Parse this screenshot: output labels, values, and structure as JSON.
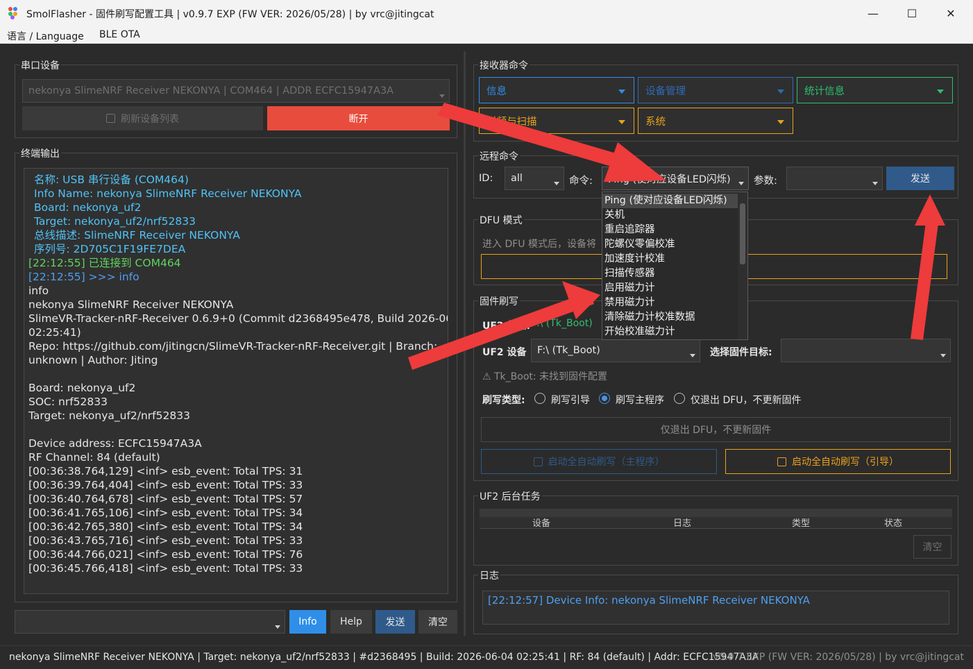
{
  "window": {
    "title": "SmolFlasher - 固件刷写配置工具 | v0.9.7 EXP (FW VER: 2026/05/28) | by vrc@jitingcat",
    "minimize": "—",
    "maximize": "☐",
    "close": "✕"
  },
  "menu": {
    "language": "语言 / Language",
    "ble_ota": "BLE OTA"
  },
  "serial": {
    "group_title": "串口设备",
    "device": "nekonya SlimeNRF Receiver NEKONYA | COM464 | ADDR ECFC15947A3A",
    "refresh_label": "刷新设备列表",
    "disconnect_label": "断开"
  },
  "terminal": {
    "group_title": "终端输出",
    "lines": [
      {
        "text": "名称: USB 串行设备 (COM464)",
        "color": "#4fc3f7",
        "indent": true
      },
      {
        "text": "Info Name: nekonya SlimeNRF Receiver NEKONYA",
        "color": "#4fc3f7",
        "indent": true
      },
      {
        "text": "Board: nekonya_uf2",
        "color": "#4fc3f7",
        "indent": true
      },
      {
        "text": "Target: nekonya_uf2/nrf52833",
        "color": "#4fc3f7",
        "indent": true
      },
      {
        "text": "总线描述: SlimeNRF Receiver NEKONYA",
        "color": "#4fc3f7",
        "indent": true
      },
      {
        "text": "序列号: 2D705C1F19FE7DEA",
        "color": "#4fc3f7",
        "indent": true
      },
      {
        "text": "[22:12:55] 已连接到 COM464",
        "color": "#5fd35f",
        "indent": false
      },
      {
        "text": "[22:12:55] >>> info",
        "color": "#4f9ff0",
        "indent": false
      },
      {
        "text": "info",
        "color": "#e6e6e6",
        "indent": false
      },
      {
        "text": "nekonya SlimeNRF Receiver NEKONYA",
        "color": "#e6e6e6",
        "indent": false
      },
      {
        "text": "SlimeVR-Tracker-nRF-Receiver 0.6.9+0 (Commit d2368495e478, Build 2026-06-04",
        "color": "#e6e6e6",
        "indent": false
      },
      {
        "text": "02:25:41)",
        "color": "#e6e6e6",
        "indent": false
      },
      {
        "text": "Repo: https://github.com/jitingcn/SlimeVR-Tracker-nRF-Receiver.git | Branch:",
        "color": "#e6e6e6",
        "indent": false
      },
      {
        "text": "unknown | Author: Jiting",
        "color": "#e6e6e6",
        "indent": false
      },
      {
        "text": "",
        "color": "#e6e6e6",
        "indent": false
      },
      {
        "text": "Board: nekonya_uf2",
        "color": "#e6e6e6",
        "indent": false
      },
      {
        "text": "SOC: nrf52833",
        "color": "#e6e6e6",
        "indent": false
      },
      {
        "text": "Target: nekonya_uf2/nrf52833",
        "color": "#e6e6e6",
        "indent": false
      },
      {
        "text": "",
        "color": "#e6e6e6",
        "indent": false
      },
      {
        "text": "Device address: ECFC15947A3A",
        "color": "#e6e6e6",
        "indent": false
      },
      {
        "text": "RF Channel: 84 (default)",
        "color": "#e6e6e6",
        "indent": false
      },
      {
        "text": "[00:36:38.764,129] <inf> esb_event: Total TPS: 31",
        "color": "#e6e6e6",
        "indent": false
      },
      {
        "text": "[00:36:39.764,404] <inf> esb_event: Total TPS: 33",
        "color": "#e6e6e6",
        "indent": false
      },
      {
        "text": "[00:36:40.764,678] <inf> esb_event: Total TPS: 57",
        "color": "#e6e6e6",
        "indent": false
      },
      {
        "text": "[00:36:41.765,106] <inf> esb_event: Total TPS: 34",
        "color": "#e6e6e6",
        "indent": false
      },
      {
        "text": "[00:36:42.765,380] <inf> esb_event: Total TPS: 34",
        "color": "#e6e6e6",
        "indent": false
      },
      {
        "text": "[00:36:43.765,716] <inf> esb_event: Total TPS: 33",
        "color": "#e6e6e6",
        "indent": false
      },
      {
        "text": "[00:36:44.766,021] <inf> esb_event: Total TPS: 76",
        "color": "#e6e6e6",
        "indent": false
      },
      {
        "text": "[00:36:45.766,418] <inf> esb_event: Total TPS: 33",
        "color": "#e6e6e6",
        "indent": false
      }
    ]
  },
  "command_bar": {
    "input": "",
    "info_label": "Info",
    "help_label": "Help",
    "send_label": "发送",
    "clear_label": "清空"
  },
  "receiver": {
    "group_title": "接收器命令",
    "info": "信息",
    "device_mgmt": "设备管理",
    "stats": "统计信息",
    "pair_scan": "射频与扫描",
    "system": "系统",
    "colors": {
      "info": "#2f8fe8",
      "device_mgmt": "#2f6ab8",
      "stats": "#2fbf71",
      "pair_scan": "#e8a21a",
      "system": "#e8a21a"
    }
  },
  "remote": {
    "group_title": "远程命令",
    "id_label": "ID:",
    "id_value": "all",
    "cmd_label": "命令:",
    "cmd_value": "Ping (使对应设备LED闪烁)",
    "param_label": "参数:",
    "param_value": "",
    "send_label": "发送",
    "options": [
      "Ping (使对应设备LED闪烁)",
      "关机",
      "重启追踪器",
      "陀螺仪零偏校准",
      "加速度计校准",
      "扫描传感器",
      "启用磁力计",
      "禁用磁力计",
      "清除磁力计校准数据",
      "开始校准磁力计"
    ]
  },
  "dfu": {
    "group_title": "DFU 模式",
    "hint": "进入 DFU 模式后，设备将"
  },
  "firmware": {
    "group_title": "固件刷写",
    "uf2_status_label": "UF2 状态:",
    "uf2_status_value": "F:\\ (Tk_Boot)",
    "uf2_device_label": "UF2 设备",
    "uf2_device_value": "F:\\ (Tk_Boot)",
    "target_label": "选择固件目标:",
    "target_value": "",
    "warning": "⚠ Tk_Boot: 未找到固件配置",
    "type_label": "刷写类型:",
    "radio_boot": "刷写引导",
    "radio_main": "刷写主程序",
    "radio_exit": "仅退出 DFU，不更新固件",
    "exit_button": "仅退出 DFU，不更新固件",
    "auto_main": "启动全自动刷写（主程序）",
    "auto_boot": "启动全自动刷写（引导）"
  },
  "uf2_tasks": {
    "group_title": "UF2 后台任务",
    "headers": [
      "设备",
      "日志",
      "类型",
      "状态"
    ],
    "clear_label": "清空"
  },
  "log": {
    "group_title": "日志",
    "entry": "[22:12:57] Device Info: nekonya SlimeNRF Receiver NEKONYA"
  },
  "status": {
    "left": "nekonya SlimeNRF Receiver NEKONYA | Target: nekonya_uf2/nrf52833 | #d2368495 | Build: 2026-06-04 02:25:41 | RF: 84 (default) | Addr: ECFC15947A3A",
    "right": "v0.9.7 EXP (FW VER: 2026/05/28) | by vrc@jitingcat"
  }
}
